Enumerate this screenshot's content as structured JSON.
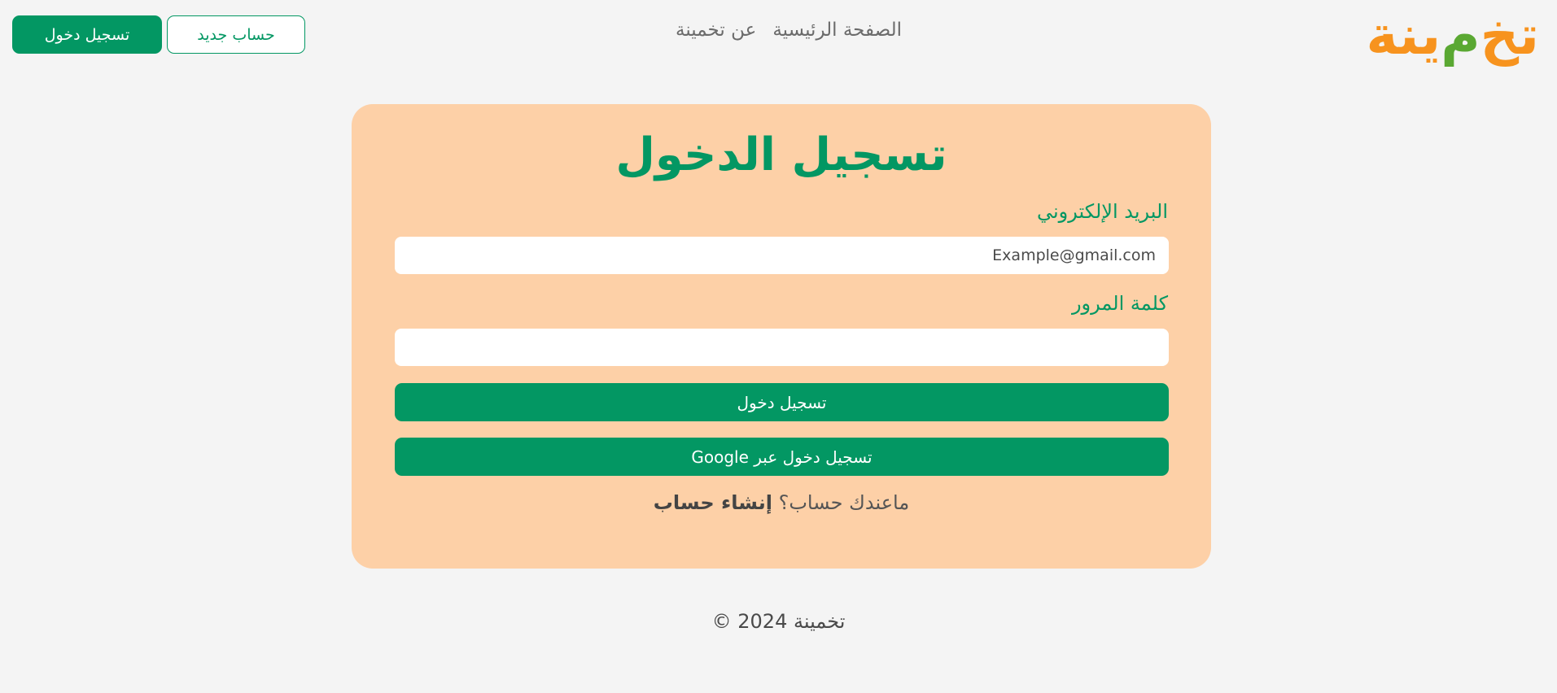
{
  "header": {
    "logo": {
      "part1": "تخ",
      "part2": "م",
      "part3": "ينة"
    },
    "nav": {
      "home": "الصفحة الرئيسية",
      "about": "عن تخمينة"
    },
    "buttons": {
      "login": "تسجيل دخول",
      "signup": "حساب جديد"
    }
  },
  "form": {
    "title": "تسجيل الدخول",
    "email_label": "البريد الإلكتروني",
    "email_placeholder": "Example@gmail.com",
    "password_label": "كلمة المرور",
    "submit_label": "تسجيل دخول",
    "google_label": "تسجيل دخول عبر Google",
    "no_account_text": "ماعندك حساب؟",
    "create_account_link": "إنشاء حساب"
  },
  "footer": {
    "text": "تخمينة 2024 ©"
  },
  "colors": {
    "primary": "#039763",
    "card_background": "#fdd0a7",
    "logo_orange": "#f7931e",
    "logo_green": "#5aa832"
  }
}
